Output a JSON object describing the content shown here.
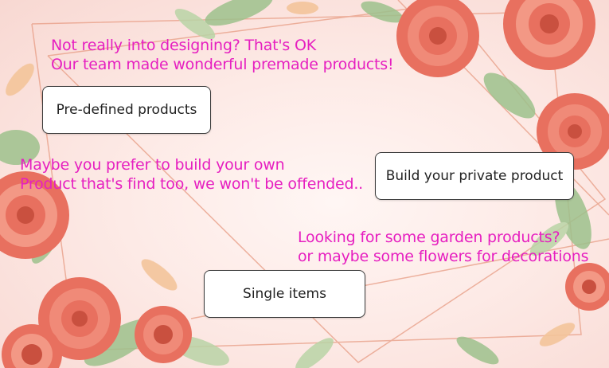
{
  "theme": {
    "message_color": "#e61fc0",
    "button_border": "#3a3a3a",
    "rose_color": "#e8705f",
    "leaf_color": "#9cc18c",
    "frame_color": "#e9a18a"
  },
  "sections": [
    {
      "message_lines": [
        "Not really into designing? That's OK",
        "Our team made wonderful premade products!"
      ],
      "button_label": "Pre-defined products"
    },
    {
      "message_lines": [
        "Maybe you prefer to build your own",
        "Product that's find too, we won't be offended.."
      ],
      "button_label": "Build your private product"
    },
    {
      "message_lines": [
        "Looking for some garden products?",
        "or maybe some flowers for decorations"
      ],
      "button_label": "Single items"
    }
  ]
}
